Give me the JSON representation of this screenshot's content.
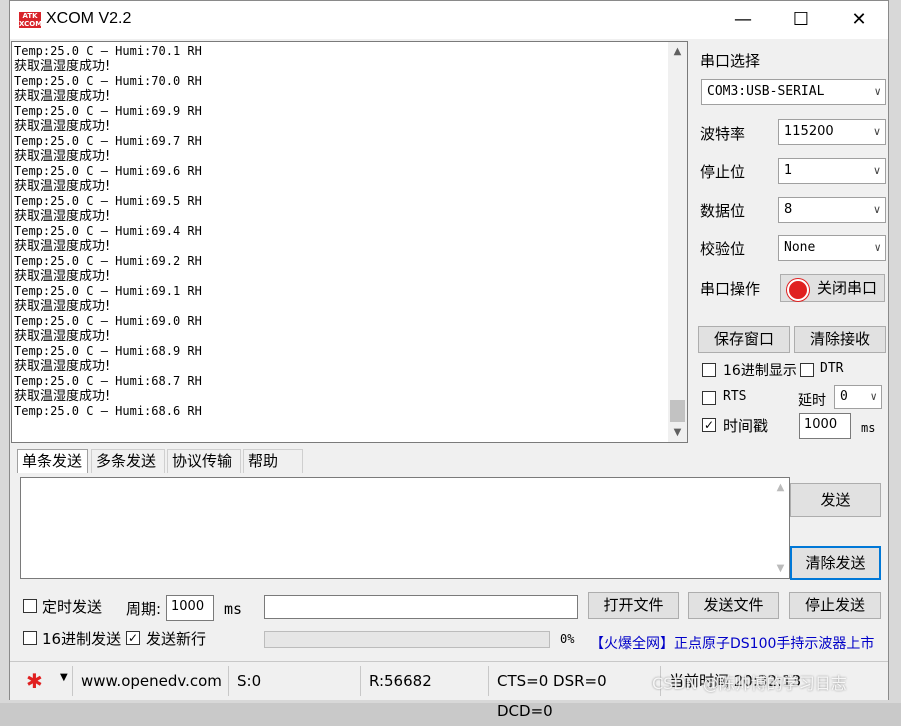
{
  "window": {
    "title": "XCOM V2.2",
    "logo_text": "ATK XCOM"
  },
  "rx_lines": [
    {
      "kind": "en",
      "text": "Temp:25.0 C — Humi:70.1 RH"
    },
    {
      "kind": "zh",
      "text": "获取温湿度成功!"
    },
    {
      "kind": "en",
      "text": "Temp:25.0 C — Humi:70.0 RH"
    },
    {
      "kind": "zh",
      "text": "获取温湿度成功!"
    },
    {
      "kind": "en",
      "text": "Temp:25.0 C — Humi:69.9 RH"
    },
    {
      "kind": "zh",
      "text": "获取温湿度成功!"
    },
    {
      "kind": "en",
      "text": "Temp:25.0 C — Humi:69.7 RH"
    },
    {
      "kind": "zh",
      "text": "获取温湿度成功!"
    },
    {
      "kind": "en",
      "text": "Temp:25.0 C — Humi:69.6 RH"
    },
    {
      "kind": "zh",
      "text": "获取温湿度成功!"
    },
    {
      "kind": "en",
      "text": "Temp:25.0 C — Humi:69.5 RH"
    },
    {
      "kind": "zh",
      "text": "获取温湿度成功!"
    },
    {
      "kind": "en",
      "text": "Temp:25.0 C — Humi:69.4 RH"
    },
    {
      "kind": "zh",
      "text": "获取温湿度成功!"
    },
    {
      "kind": "en",
      "text": "Temp:25.0 C — Humi:69.2 RH"
    },
    {
      "kind": "zh",
      "text": "获取温湿度成功!"
    },
    {
      "kind": "en",
      "text": "Temp:25.0 C — Humi:69.1 RH"
    },
    {
      "kind": "zh",
      "text": "获取温湿度成功!"
    },
    {
      "kind": "en",
      "text": "Temp:25.0 C — Humi:69.0 RH"
    },
    {
      "kind": "zh",
      "text": "获取温湿度成功!"
    },
    {
      "kind": "en",
      "text": "Temp:25.0 C — Humi:68.9 RH"
    },
    {
      "kind": "zh",
      "text": "获取温湿度成功!"
    },
    {
      "kind": "en",
      "text": "Temp:25.0 C — Humi:68.7 RH"
    },
    {
      "kind": "zh",
      "text": "获取温湿度成功!"
    },
    {
      "kind": "en",
      "text": "Temp:25.0 C — Humi:68.6 RH"
    }
  ],
  "settings": {
    "port_label": "串口选择",
    "port_value": "COM3:USB-SERIAL",
    "baud_label": "波特率",
    "baud_value": "115200",
    "stop_label": "停止位",
    "stop_value": "1",
    "data_label": "数据位",
    "data_value": "8",
    "parity_label": "校验位",
    "parity_value": "None",
    "op_label": "串口操作",
    "close_port": "关闭串口",
    "save_window": "保存窗口",
    "clear_recv": "清除接收",
    "hex_display": "16进制显示",
    "dtr": "DTR",
    "rts": "RTS",
    "delay_label": "延时",
    "delay_value": "0",
    "timestamp": "时间戳",
    "timestamp_value": "1000",
    "ms": "ms"
  },
  "tabs": [
    "单条发送",
    "多条发送",
    "协议传输",
    "帮助"
  ],
  "send": {
    "send_btn": "发送",
    "clear_send": "清除发送",
    "timed_send": "定时发送",
    "period_label": "周期:",
    "period_value": "1000",
    "ms": "ms",
    "open_file": "打开文件",
    "send_file": "发送文件",
    "stop_send": "停止发送",
    "hex_send": "16进制发送",
    "newline": "发送新行",
    "percent": "0%",
    "ad_text": "【火爆全网】正点原子DS100手持示波器上市"
  },
  "statusbar": {
    "url": "www.openedv.com",
    "s": "S:0",
    "r": "R:56682",
    "signals": "CTS=0 DSR=0 DCD=0",
    "time": "当前时间 20:32:13"
  },
  "watermark": "CSDN @陈帅博的学习日志",
  "colors": {
    "accent_red": "#e02020",
    "ad_blue": "#0000c8"
  }
}
